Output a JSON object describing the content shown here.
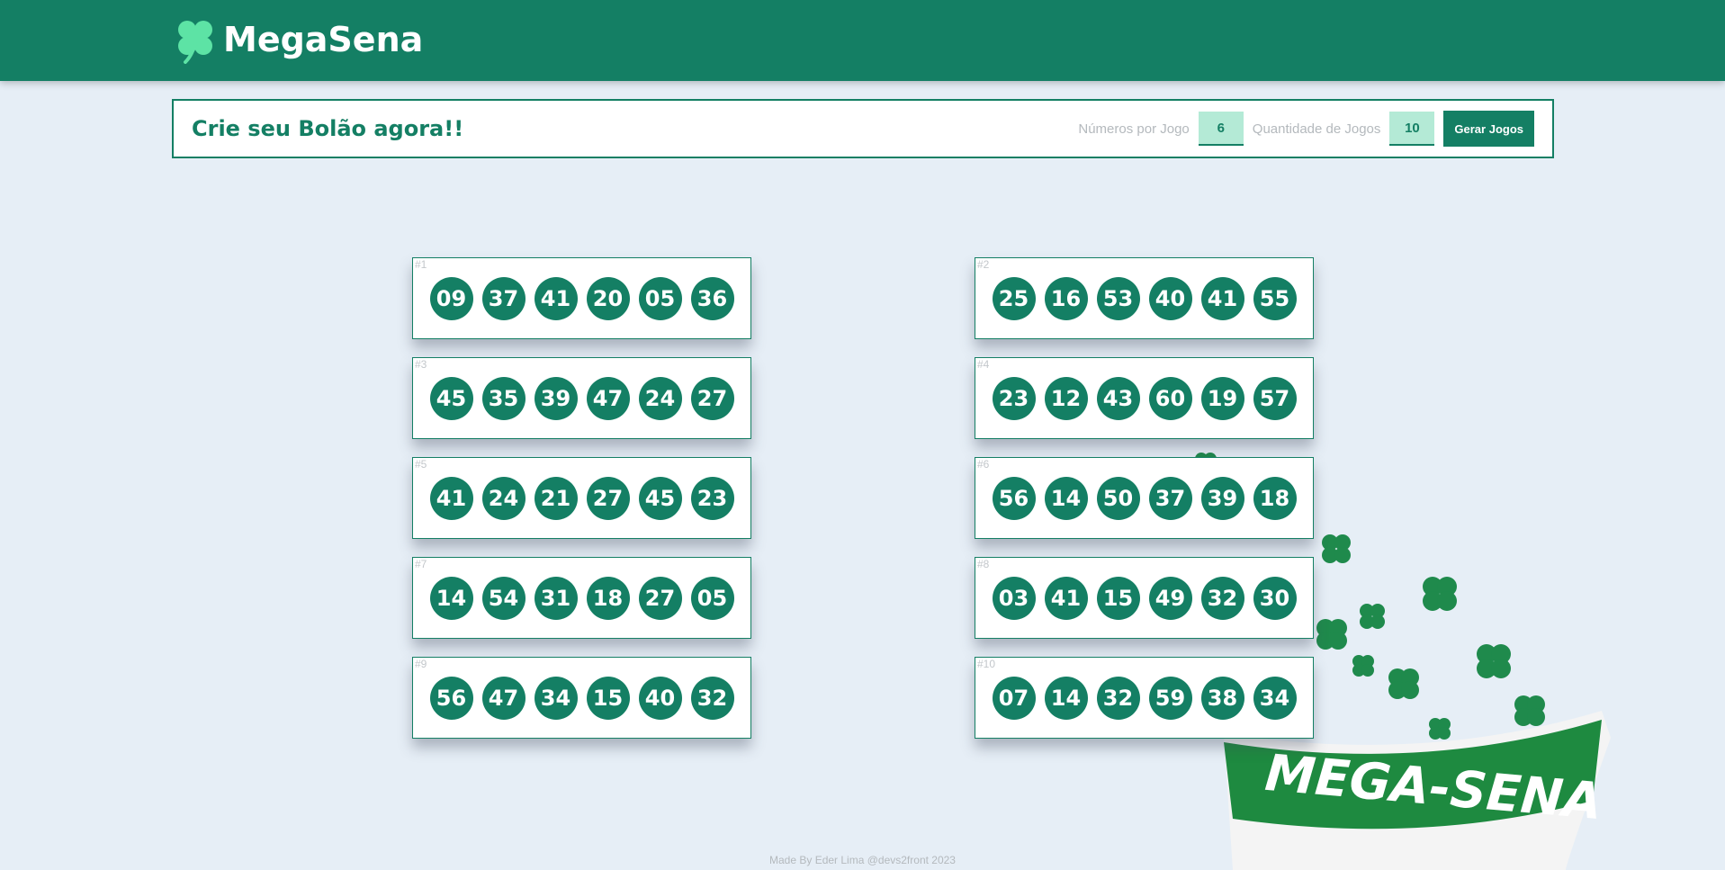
{
  "header": {
    "brand": "MegaSena",
    "logo_icon": "clover-icon",
    "brand_color": "#147f64"
  },
  "bolao": {
    "title": "Crie seu Bolão agora!!",
    "numbers_label": "Números por Jogo",
    "numbers_value": "6",
    "games_label": "Quantidade de Jogos",
    "games_value": "10",
    "generate_label": "Gerar Jogos"
  },
  "games": [
    {
      "label": "#1",
      "numbers": [
        "09",
        "37",
        "41",
        "20",
        "05",
        "36"
      ]
    },
    {
      "label": "#2",
      "numbers": [
        "25",
        "16",
        "53",
        "40",
        "41",
        "55"
      ]
    },
    {
      "label": "#3",
      "numbers": [
        "45",
        "35",
        "39",
        "47",
        "24",
        "27"
      ]
    },
    {
      "label": "#4",
      "numbers": [
        "23",
        "12",
        "43",
        "60",
        "19",
        "57"
      ]
    },
    {
      "label": "#5",
      "numbers": [
        "41",
        "24",
        "21",
        "27",
        "45",
        "23"
      ]
    },
    {
      "label": "#6",
      "numbers": [
        "56",
        "14",
        "50",
        "37",
        "39",
        "18"
      ]
    },
    {
      "label": "#7",
      "numbers": [
        "14",
        "54",
        "31",
        "18",
        "27",
        "05"
      ]
    },
    {
      "label": "#8",
      "numbers": [
        "03",
        "41",
        "15",
        "49",
        "32",
        "30"
      ]
    },
    {
      "label": "#9",
      "numbers": [
        "56",
        "47",
        "34",
        "15",
        "40",
        "32"
      ]
    },
    {
      "label": "#10",
      "numbers": [
        "07",
        "14",
        "32",
        "59",
        "38",
        "34"
      ]
    }
  ],
  "decoration": {
    "banner_text": "MEGA-SENA",
    "icon": "mega-sena-ticket-icon"
  },
  "footer": {
    "text": "Made By Eder Lima @devs2front 2023"
  }
}
